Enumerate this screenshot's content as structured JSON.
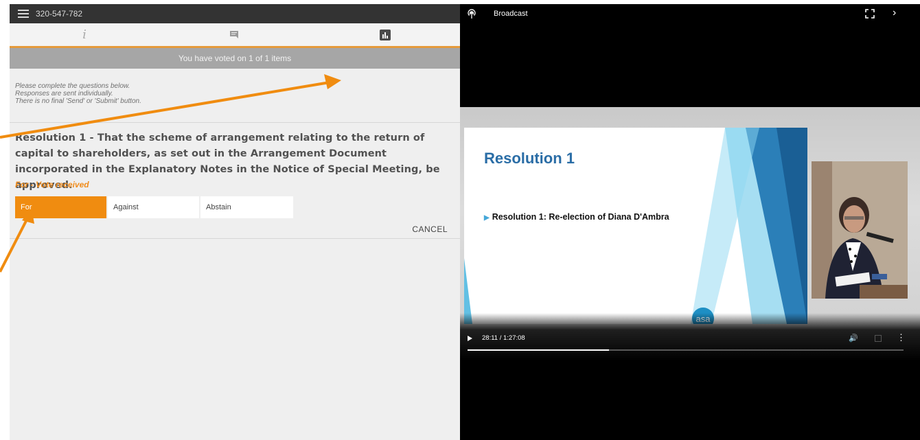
{
  "left": {
    "meeting_id": "320-547-782",
    "tabs": [
      {
        "name": "info",
        "icon": "info-icon"
      },
      {
        "name": "questions",
        "icon": "chat-icon"
      },
      {
        "name": "voting",
        "icon": "poll-icon"
      }
    ],
    "status": "You have voted on 1 of 1 items",
    "instructions": [
      "Please complete the questions below.",
      "Responses are sent individually.",
      "There is no final 'Send' or 'Submit' button."
    ],
    "resolution": "Resolution 1 - That the scheme of arrangement relating to the return of capital to shareholders, as set out in the Arrangement Document incorporated in the Explanatory Notes in the Notice of Special Meeting, be approved.",
    "vote_status": "For - Vote received",
    "options": [
      "For",
      "Against",
      "Abstain"
    ],
    "selected_option": "For",
    "cancel": "CANCEL",
    "accent_color": "#f08c10"
  },
  "right": {
    "title": "Broadcast",
    "slide": {
      "title": "Resolution 1",
      "bullet": "Resolution 1: Re-election of Diana D'Ambra",
      "logo": "asa"
    },
    "player": {
      "time": "28:11 / 1:27:08",
      "progress": 0.324
    }
  }
}
